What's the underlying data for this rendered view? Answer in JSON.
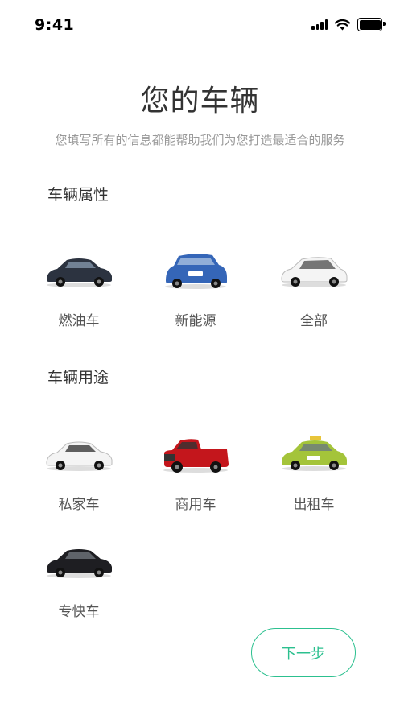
{
  "status_bar": {
    "time": "9:41"
  },
  "title": "您的车辆",
  "subtitle": "您填写所有的信息都能帮助我们为您打造最适合的服务",
  "sections": [
    {
      "title": "车辆属性",
      "items": [
        {
          "label": "燃油车",
          "icon": "sedan-icon",
          "color": "#2c3340"
        },
        {
          "label": "新能源",
          "icon": "suv-icon",
          "color": "#3566b8"
        },
        {
          "label": "全部",
          "icon": "hatchback-icon",
          "color": "#f4f4f4"
        }
      ]
    },
    {
      "title": "车辆用途",
      "items": [
        {
          "label": "私家车",
          "icon": "sedan-icon",
          "color": "#f4f4f4"
        },
        {
          "label": "商用车",
          "icon": "pickup-truck-icon",
          "color": "#c4161c"
        },
        {
          "label": "出租车",
          "icon": "taxi-icon",
          "color": "#a4c43a"
        },
        {
          "label": "专快车",
          "icon": "sedan-icon",
          "color": "#1e1e22"
        }
      ]
    }
  ],
  "next_button": "下一步",
  "accent_color": "#2cc08f"
}
